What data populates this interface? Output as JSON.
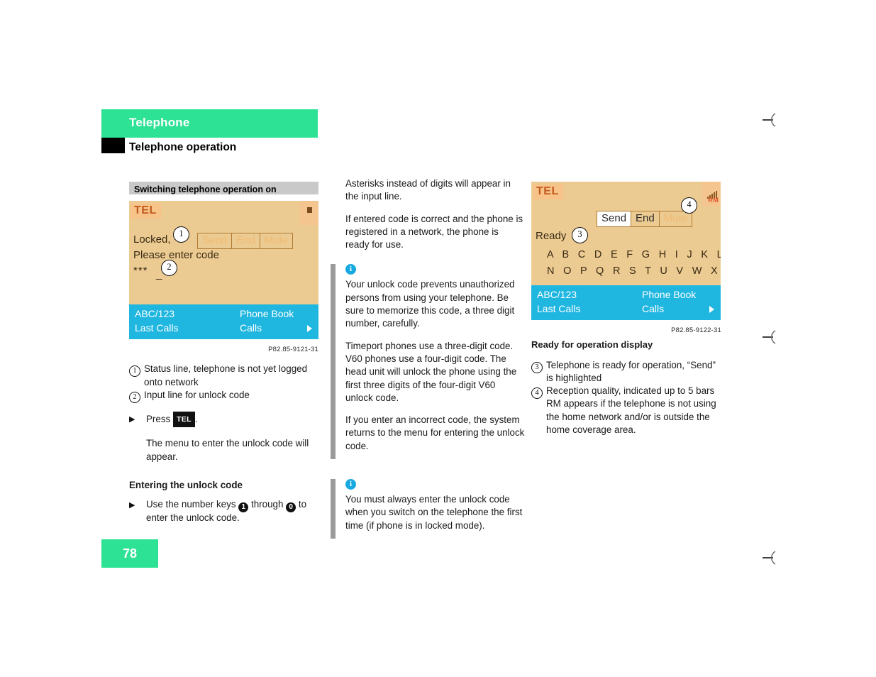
{
  "header": {
    "chapter": "Telephone",
    "section": "Telephone operation"
  },
  "page_number": "78",
  "left_column": {
    "subsection_title": "Switching telephone operation on",
    "figure": {
      "code": "P82.85-9121-31",
      "tel_tag": "TEL",
      "line_status": "Locked,",
      "line_prompt": "Please enter code",
      "line_input": "***",
      "cursor": "_",
      "softkeys": [
        "Send",
        "End",
        "Mute"
      ],
      "menu": {
        "left_top": "ABC/123",
        "left_bottom": "Last Calls",
        "right_top": "Phone Book",
        "right_bottom": "Calls"
      },
      "callouts": [
        "1",
        "2"
      ]
    },
    "legend": [
      {
        "num": "1",
        "text": "Status line, telephone is not yet logged onto network"
      },
      {
        "num": "2",
        "text": "Input line for unlock code"
      }
    ],
    "step_press": {
      "arrow": "▶",
      "lead": "Press",
      "key": "TEL",
      "trail": ".",
      "result": "The menu to enter the unlock code will appear."
    },
    "unlock_heading": "Entering the unlock code",
    "step_numbers": {
      "arrow": "▶",
      "part1": "Use the number keys",
      "key1": "1",
      "part2": "through",
      "key2": "0",
      "part3": "to enter the unlock code."
    }
  },
  "middle_column": {
    "para1": "Asterisks instead of digits will appear in the input line.",
    "para2": "If entered code is correct and the phone is registered in a network, the phone is ready for use.",
    "note1": {
      "icon": "info-icon",
      "para1": "Your unlock code prevents unauthorized persons from using your telephone. Be sure to memorize this code, a three digit number, carefully.",
      "para2": "Timeport phones use a three-digit code. V60 phones use a four-digit code. The head unit will unlock the phone using the first three digits of the four-digit V60 unlock code.",
      "para3": "If you enter an incorrect code, the system returns to the menu for entering the unlock code."
    },
    "note2": {
      "icon": "info-icon",
      "para1": "You must always enter the unlock code when you switch on the telephone the first time (if phone is in locked mode)."
    }
  },
  "right_column": {
    "figure": {
      "code": "P82.85-9122-31",
      "tel_tag": "TEL",
      "line_status": "Ready",
      "softkeys": [
        "Send",
        "End",
        "Mute"
      ],
      "alphabet_row1": "A B C D E F G H I J K L M",
      "alphabet_row2": "N O P Q R S T U V W X Y Z",
      "signal_label": "RM",
      "menu": {
        "left_top": "ABC/123",
        "left_bottom": "Last Calls",
        "right_top": "Phone Book",
        "right_bottom": "Calls"
      },
      "callouts": [
        "3",
        "4"
      ]
    },
    "caption": "Ready for operation display",
    "legend": [
      {
        "num": "3",
        "text": "Telephone is ready for operation, “Send” is highlighted"
      },
      {
        "num": "4",
        "text": "Reception quality, indicated up to 5 bars\nRM appears if the telephone is not using the home network and/or is outside the home coverage area."
      }
    ]
  },
  "colors": {
    "brand_green": "#2de295",
    "display_amber": "#eccb92",
    "display_blue": "#1fb6e0",
    "info_blue": "#18a9e0",
    "note_bar_gray": "#9a9a9a",
    "subsection_gray": "#c9c9c9"
  }
}
